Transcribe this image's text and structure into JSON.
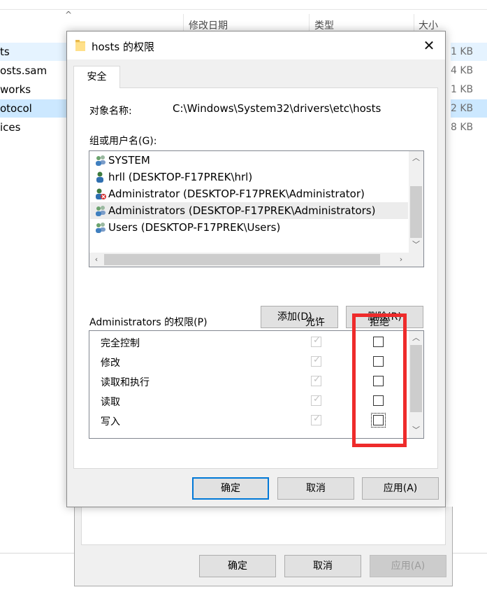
{
  "explorer": {
    "columns": {
      "modified": "修改日期",
      "type": "类型",
      "size": "大小"
    },
    "files": [
      {
        "name": "ts",
        "size": "1 KB"
      },
      {
        "name": "osts.sam",
        "size": "4 KB"
      },
      {
        "name": "works",
        "size": "1 KB"
      },
      {
        "name": "otocol",
        "size": "2 KB"
      },
      {
        "name": "ices",
        "size": "8 KB"
      }
    ]
  },
  "back_dialog": {
    "ok_label": "确定",
    "cancel_label": "取消",
    "apply_label": "应用(A)"
  },
  "dialog": {
    "title": "hosts 的权限",
    "close_glyph": "✕",
    "tab_label": "安全",
    "object_label": "对象名称:",
    "object_value": "C:\\Windows\\System32\\drivers\\etc\\hosts",
    "group_label": "组或用户名(G):",
    "users": [
      {
        "name": "SYSTEM",
        "icon": "group-icon"
      },
      {
        "name": "hrll (DESKTOP-F17PREK\\hrl)",
        "icon": "user-icon"
      },
      {
        "name": "Administrator (DESKTOP-F17PREK\\Administrator)",
        "icon": "disabled-user-icon"
      },
      {
        "name": "Administrators (DESKTOP-F17PREK\\Administrators)",
        "icon": "group-icon",
        "selected": true
      },
      {
        "name": "Users (DESKTOP-F17PREK\\Users)",
        "icon": "group-icon"
      }
    ],
    "add_label": "添加(D)...",
    "remove_label": "删除(R)",
    "perm_title": "Administrators 的权限(P)",
    "allow_label": "允许",
    "deny_label": "拒绝",
    "permissions": [
      {
        "name": "完全控制",
        "allow": true,
        "deny": false
      },
      {
        "name": "修改",
        "allow": true,
        "deny": false
      },
      {
        "name": "读取和执行",
        "allow": true,
        "deny": false
      },
      {
        "name": "读取",
        "allow": true,
        "deny": false
      },
      {
        "name": "写入",
        "allow": true,
        "deny": false
      }
    ],
    "ok_label": "确定",
    "cancel_label": "取消",
    "apply_label": "应用(A)"
  },
  "colors": {
    "highlight_box": "#ee2b2b",
    "primary_border": "#0078d7"
  }
}
